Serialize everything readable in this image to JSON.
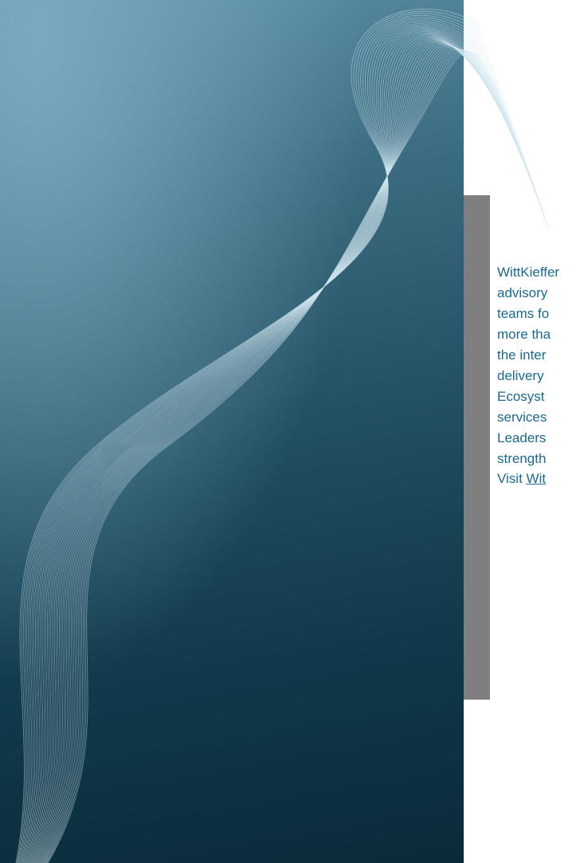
{
  "document": {
    "body_lines": [
      "WittKieffer",
      "advisory",
      "teams fo",
      "more tha",
      "the inter",
      "delivery",
      "Ecosyst",
      "services",
      "Leaders",
      "strength"
    ],
    "visit_prefix": "Visit ",
    "visit_link": "Wit"
  },
  "colors": {
    "panel_top": "#7aaabf",
    "panel_bottom": "#0b2a38",
    "accent_bar": "#7f7f7f",
    "text": "#1b6a8f"
  }
}
